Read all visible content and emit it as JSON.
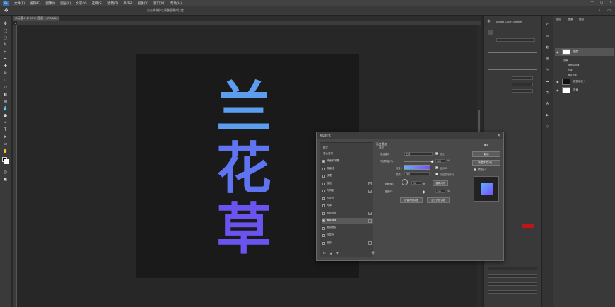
{
  "menubar": {
    "logo": "Ps",
    "items": [
      "文件(F)",
      "编辑(E)",
      "图像(I)",
      "图层(L)",
      "文字(Y)",
      "选择(S)",
      "滤镜(T)",
      "3D(D)",
      "视图(V)",
      "窗口(W)",
      "帮助(H)"
    ],
    "window_controls": [
      "—",
      "□",
      "✕"
    ]
  },
  "optbar": {
    "hint": "点击并拖移以调整图像对比度"
  },
  "doctab": {
    "label": "未标题-1 @ 50% (图层 1, RGB/8#) *"
  },
  "dialog": {
    "title": "图层样式",
    "close": "✕",
    "styles_header": "样式",
    "blend_header": "混合选项",
    "items": [
      {
        "label": "斜面和浮雕",
        "checked": true,
        "plus": false
      },
      {
        "label": "等高线",
        "checked": false,
        "plus": false
      },
      {
        "label": "纹理",
        "checked": false,
        "plus": false
      },
      {
        "label": "描边",
        "checked": false,
        "plus": true
      },
      {
        "label": "内阴影",
        "checked": false,
        "plus": true
      },
      {
        "label": "内发光",
        "checked": false,
        "plus": false
      },
      {
        "label": "光泽",
        "checked": false,
        "plus": false
      },
      {
        "label": "颜色叠加",
        "checked": false,
        "plus": true
      },
      {
        "label": "渐变叠加",
        "checked": true,
        "plus": true
      },
      {
        "label": "图案叠加",
        "checked": false,
        "plus": false
      },
      {
        "label": "外发光",
        "checked": false,
        "plus": false
      },
      {
        "label": "投影",
        "checked": false,
        "plus": true
      }
    ],
    "list_footer": [
      "fx",
      "▲",
      "▼",
      "🗑"
    ],
    "panel": {
      "group_title": "渐变叠加",
      "sub_title": "渐变",
      "blend_mode_label": "混合模式:",
      "blend_mode_value": "正常",
      "dither_label": "仿色",
      "opacity_label": "不透明度(P):",
      "opacity_value": "100",
      "percent": "%",
      "gradient_label": "渐变:",
      "reverse_label": "反向(R)",
      "style_label": "样式:",
      "style_value": "线性",
      "align_label": "与图层对齐(I)",
      "angle_label": "角度(N):",
      "angle_value": "90",
      "degree": "度",
      "reset_align_label": "重置对齐",
      "scale_label": "缩放(S):",
      "scale_value": "100",
      "default_button": "设置为默认值",
      "reset_default_button": "复位为默认值"
    },
    "right": {
      "ok": "确定",
      "cancel": "取消",
      "new_style": "新建样式(W)...",
      "preview_label": "预览(V)"
    }
  },
  "colorpanel": {
    "title": "Adobe Color Themes"
  },
  "layers": {
    "tabs": [
      "图层",
      "通道",
      "路径"
    ],
    "rows": [
      {
        "name": "图层 1",
        "selected": true,
        "dark": false
      },
      {
        "name": "颜色填充 1",
        "selected": false,
        "dark": true
      },
      {
        "name": "背景",
        "selected": false,
        "dark": false
      }
    ],
    "effects": [
      "效果",
      "斜面和浮雕",
      "光泽",
      "渐变叠加"
    ]
  },
  "art": {
    "line1": "兰",
    "line2": "花",
    "line3": "草"
  },
  "colors": {
    "accent_gradient_start": "#5bb2ff",
    "accent_gradient_end": "#7a4dff",
    "red_swatch": "#c0141c"
  }
}
